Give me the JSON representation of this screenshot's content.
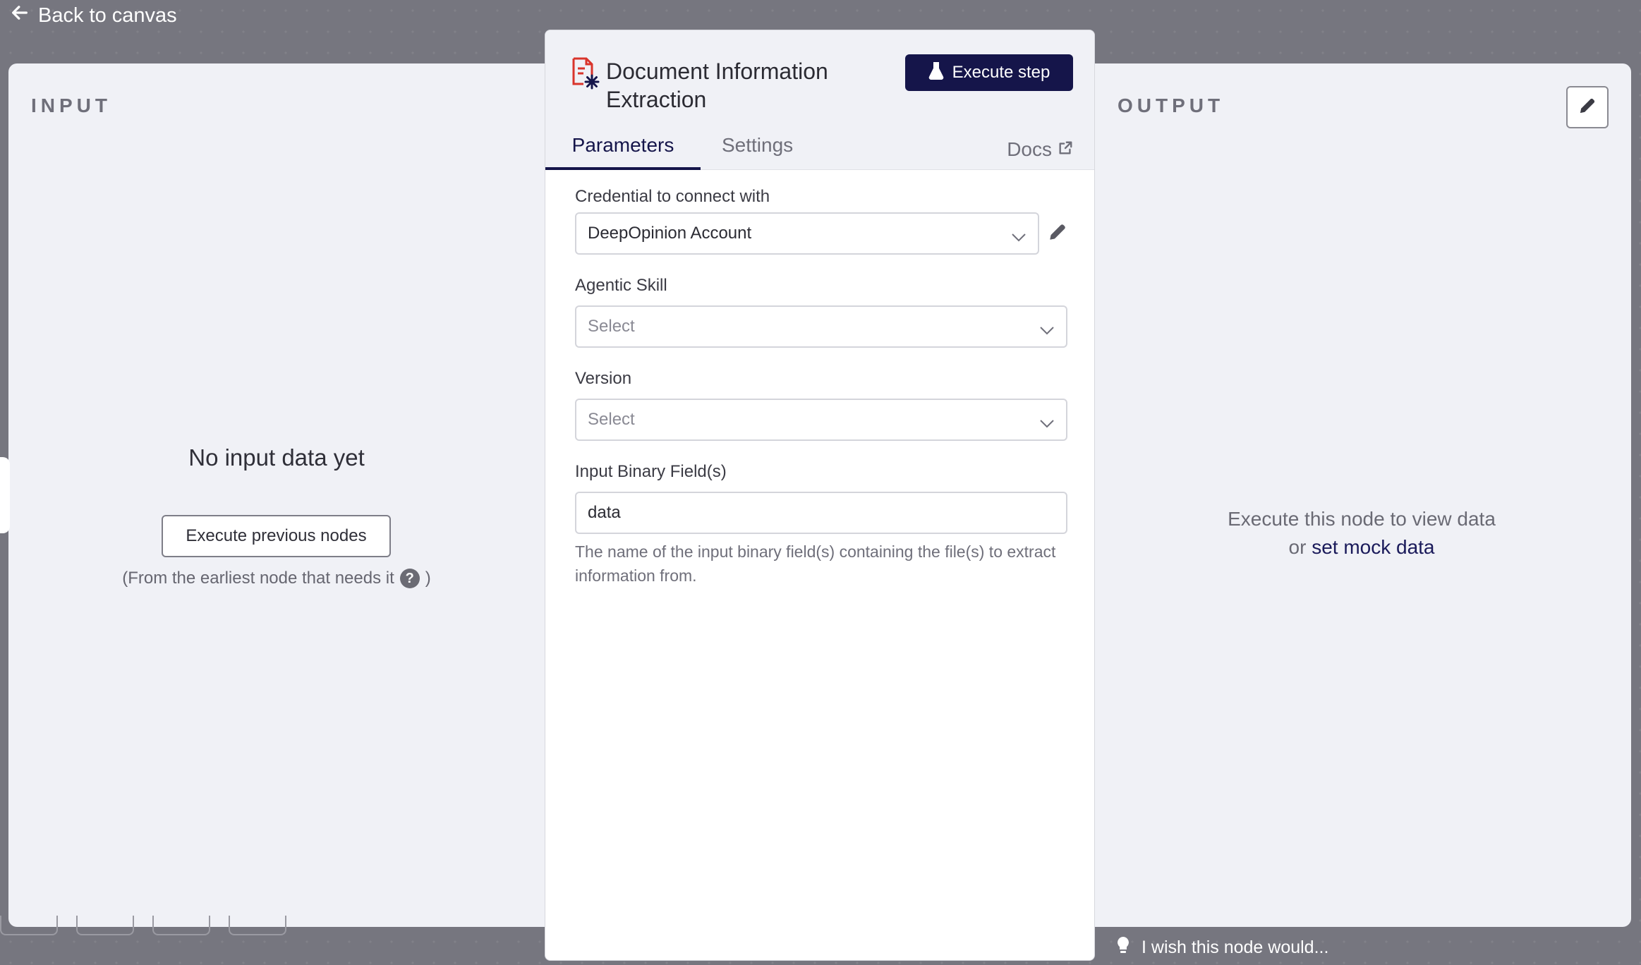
{
  "nav": {
    "back_label": "Back to canvas"
  },
  "input_panel": {
    "title": "INPUT",
    "empty_message": "No input data yet",
    "execute_previous_label": "Execute previous nodes",
    "hint_text": "(From the earliest node that needs it",
    "hint_close": ")"
  },
  "output_panel": {
    "title": "OUTPUT",
    "message": "Execute this node to view data",
    "or_text": "or",
    "mock_link": "set mock data"
  },
  "node": {
    "title": "Document Information Extraction",
    "execute_label": "Execute step",
    "tabs": [
      {
        "label": "Parameters",
        "active": true
      },
      {
        "label": "Settings",
        "active": false
      },
      {
        "label": "Docs",
        "active": false
      }
    ],
    "fields": {
      "credential": {
        "label": "Credential to connect with",
        "value": "DeepOpinion Account"
      },
      "agentic_skill": {
        "label": "Agentic Skill",
        "placeholder": "Select"
      },
      "version": {
        "label": "Version",
        "placeholder": "Select"
      },
      "binary_field": {
        "label": "Input Binary Field(s)",
        "value": "data",
        "hint": "The name of the input binary field(s) containing the file(s) to extract information from."
      }
    }
  },
  "feedback": {
    "wish_label": "I wish this node would..."
  },
  "colors": {
    "accent": "#15154a",
    "node_icon": "#d9342b",
    "backdrop": "#76767f",
    "panel": "#f0f1f6"
  },
  "icons": [
    "arrow-left-icon",
    "flask-icon",
    "external-link-icon",
    "chevron-down-icon",
    "pencil-icon",
    "help-icon",
    "lightbulb-icon",
    "document-extraction-icon"
  ]
}
